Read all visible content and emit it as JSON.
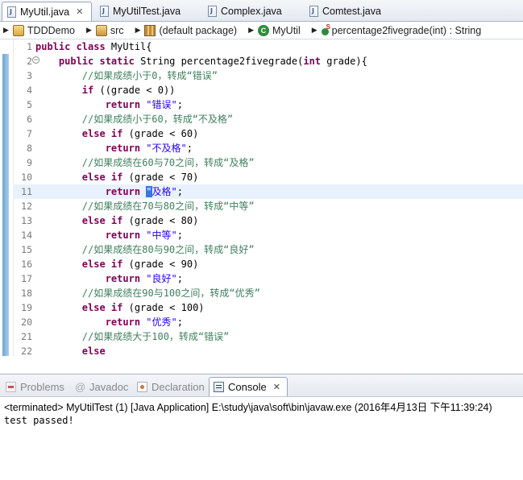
{
  "tabs": [
    {
      "label": "MyUtil.java",
      "icon": "java-file-icon",
      "active": true,
      "close": "✕"
    },
    {
      "label": "MyUtilTest.java",
      "icon": "java-file-icon",
      "active": false
    },
    {
      "label": "Complex.java",
      "icon": "java-file-icon",
      "active": false
    },
    {
      "label": "Comtest.java",
      "icon": "java-file-icon",
      "active": false
    }
  ],
  "breadcrumb": [
    {
      "label": "TDDDemo",
      "icon": "project-icon"
    },
    {
      "label": "src",
      "icon": "source-folder-icon"
    },
    {
      "label": "(default package)",
      "icon": "package-icon"
    },
    {
      "label": "MyUtil",
      "icon": "class-icon"
    },
    {
      "label": "percentage2fivegrade(int) : String",
      "icon": "method-icon"
    }
  ],
  "editor": {
    "lines": [
      {
        "n": "1",
        "tokens": [
          [
            "kw",
            "public class "
          ],
          [
            "id",
            "MyUtil{"
          ]
        ]
      },
      {
        "n": "2",
        "fold": true,
        "tokens": [
          [
            "id",
            "    "
          ],
          [
            "kw",
            "public static "
          ],
          [
            "id",
            "String percentage2fivegrade("
          ],
          [
            "kw",
            "int "
          ],
          [
            "id",
            "grade){"
          ]
        ]
      },
      {
        "n": "3",
        "tokens": [
          [
            "id",
            "        "
          ],
          [
            "cm",
            "//如果成绩小于0，转成“错误”"
          ]
        ]
      },
      {
        "n": "4",
        "tokens": [
          [
            "id",
            "        "
          ],
          [
            "kw",
            "if "
          ],
          [
            "id",
            "((grade < 0))"
          ]
        ]
      },
      {
        "n": "5",
        "tokens": [
          [
            "id",
            "            "
          ],
          [
            "kw",
            "return "
          ],
          [
            "st",
            "\"错误\""
          ],
          [
            "id",
            ";"
          ]
        ]
      },
      {
        "n": "6",
        "tokens": [
          [
            "id",
            "        "
          ],
          [
            "cm",
            "//如果成绩小于60，转成“不及格”"
          ]
        ]
      },
      {
        "n": "7",
        "tokens": [
          [
            "id",
            "        "
          ],
          [
            "kw",
            "else if "
          ],
          [
            "id",
            "(grade < 60)"
          ]
        ]
      },
      {
        "n": "8",
        "tokens": [
          [
            "id",
            "            "
          ],
          [
            "kw",
            "return "
          ],
          [
            "st",
            "\"不及格\""
          ],
          [
            "id",
            ";"
          ]
        ]
      },
      {
        "n": "9",
        "tokens": [
          [
            "id",
            "        "
          ],
          [
            "cm",
            "//如果成绩在60与70之间，转成“及格”"
          ]
        ]
      },
      {
        "n": "10",
        "tokens": [
          [
            "id",
            "        "
          ],
          [
            "kw",
            "else if "
          ],
          [
            "id",
            "(grade < 70)"
          ]
        ]
      },
      {
        "n": "11",
        "current": true,
        "tokens": [
          [
            "id",
            "            "
          ],
          [
            "kw",
            "return "
          ],
          [
            "caret",
            "\""
          ],
          [
            "st",
            "及格\""
          ],
          [
            "id",
            ";"
          ]
        ]
      },
      {
        "n": "12",
        "tokens": [
          [
            "id",
            "        "
          ],
          [
            "cm",
            "//如果成绩在70与80之间，转成“中等”"
          ]
        ]
      },
      {
        "n": "13",
        "tokens": [
          [
            "id",
            "        "
          ],
          [
            "kw",
            "else if "
          ],
          [
            "id",
            "(grade < 80)"
          ]
        ]
      },
      {
        "n": "14",
        "tokens": [
          [
            "id",
            "            "
          ],
          [
            "kw",
            "return "
          ],
          [
            "st",
            "\"中等\""
          ],
          [
            "id",
            ";"
          ]
        ]
      },
      {
        "n": "15",
        "tokens": [
          [
            "id",
            "        "
          ],
          [
            "cm",
            "//如果成绩在80与90之间，转成“良好”"
          ]
        ]
      },
      {
        "n": "16",
        "tokens": [
          [
            "id",
            "        "
          ],
          [
            "kw",
            "else if "
          ],
          [
            "id",
            "(grade < 90)"
          ]
        ]
      },
      {
        "n": "17",
        "tokens": [
          [
            "id",
            "            "
          ],
          [
            "kw",
            "return "
          ],
          [
            "st",
            "\"良好\""
          ],
          [
            "id",
            ";"
          ]
        ]
      },
      {
        "n": "18",
        "tokens": [
          [
            "id",
            "        "
          ],
          [
            "cm",
            "//如果成绩在90与100之间，转成“优秀”"
          ]
        ]
      },
      {
        "n": "19",
        "tokens": [
          [
            "id",
            "        "
          ],
          [
            "kw",
            "else if "
          ],
          [
            "id",
            "(grade < 100)"
          ]
        ]
      },
      {
        "n": "20",
        "tokens": [
          [
            "id",
            "            "
          ],
          [
            "kw",
            "return "
          ],
          [
            "st",
            "\"优秀\""
          ],
          [
            "id",
            ";"
          ]
        ]
      },
      {
        "n": "21",
        "tokens": [
          [
            "id",
            "        "
          ],
          [
            "cm",
            "//如果成绩大于100，转成“错误”"
          ]
        ]
      },
      {
        "n": "22",
        "tokens": [
          [
            "id",
            "        "
          ],
          [
            "kw",
            "else"
          ]
        ]
      }
    ]
  },
  "views": {
    "tabs": [
      {
        "label": "Problems",
        "icon": "problems-icon",
        "active": false
      },
      {
        "label": "Javadoc",
        "icon": "javadoc-icon",
        "active": false
      },
      {
        "label": "Declaration",
        "icon": "declaration-icon",
        "active": false
      },
      {
        "label": "Console",
        "icon": "console-icon",
        "active": true,
        "close": "✕"
      }
    ]
  },
  "console": {
    "status": "<terminated> MyUtilTest (1) [Java Application] E:\\study\\java\\soft\\bin\\javaw.exe (2016年4月13日 下午11:39:24)",
    "output": "test passed!"
  },
  "colors": {
    "keyword": "#7f0055",
    "comment": "#3f7f5f",
    "string": "#2a00ff",
    "current_line": "#e8f2fe"
  }
}
